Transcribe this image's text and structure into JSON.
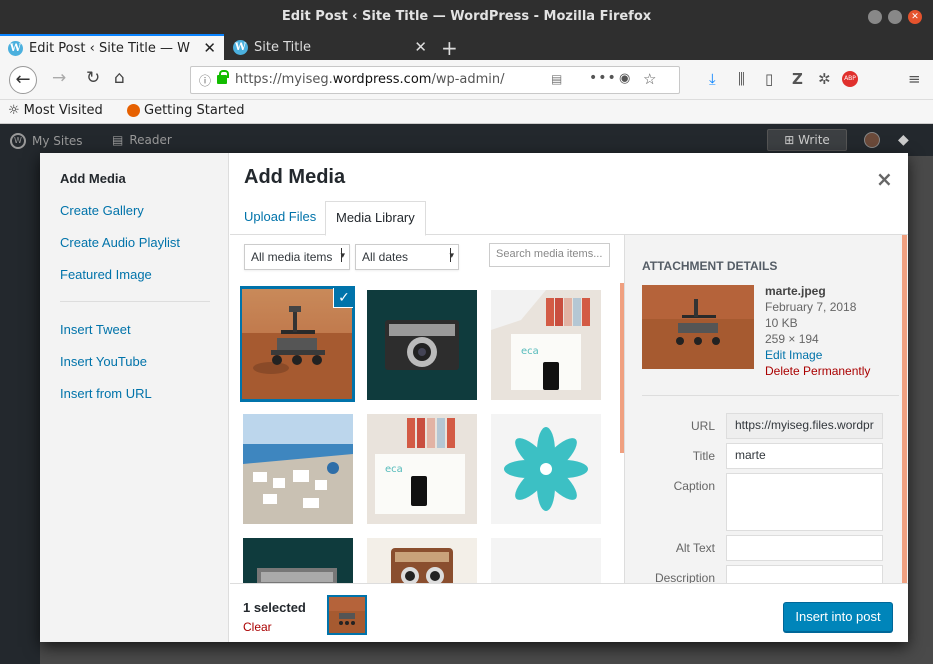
{
  "browser": {
    "window_title": "Edit Post ‹ Site Title — WordPress - Mozilla Firefox",
    "tabs": [
      {
        "label": "Edit Post ‹ Site Title — W",
        "active": true
      },
      {
        "label": "Site Title",
        "active": false
      }
    ],
    "new_tab": "+",
    "url_prefix": "https://myiseg.",
    "url_domain": "wordpress.com",
    "url_path": "/wp-admin/po",
    "bookmarks": [
      "Most Visited",
      "Getting Started"
    ]
  },
  "adminbar": {
    "my_sites": "My Sites",
    "reader": "Reader",
    "write": "Write"
  },
  "modal": {
    "title": "Add Media",
    "close": "×",
    "menu": [
      {
        "label": "Add Media",
        "active": true
      },
      {
        "label": "Create Gallery"
      },
      {
        "label": "Create Audio Playlist"
      },
      {
        "label": "Featured Image"
      },
      {
        "label": "Insert Tweet"
      },
      {
        "label": "Insert YouTube"
      },
      {
        "label": "Insert from URL"
      }
    ],
    "router_tabs": [
      {
        "label": "Upload Files",
        "active": false
      },
      {
        "label": "Media Library",
        "active": true
      }
    ],
    "filters": {
      "type": "All media items",
      "date": "All dates",
      "search_placeholder": "Search media items..."
    },
    "details": {
      "heading": "ATTACHMENT DETAILS",
      "filename": "marte.jpeg",
      "date": "February 7, 2018",
      "size": "10 KB",
      "dimensions": "259 × 194",
      "edit_link": "Edit Image",
      "delete_link": "Delete Permanently",
      "fields": {
        "url_label": "URL",
        "url_value": "https://myiseg.files.wordpr",
        "title_label": "Title",
        "title_value": "marte",
        "caption_label": "Caption",
        "caption_value": "",
        "alt_label": "Alt Text",
        "alt_value": "",
        "description_label": "Description",
        "description_value": ""
      }
    },
    "toolbar": {
      "selected_count": "1 selected",
      "clear": "Clear",
      "insert": "Insert into post"
    }
  },
  "colors": {
    "accent": "#0073aa",
    "primary_button": "#0085ba",
    "danger": "#aa0000"
  }
}
